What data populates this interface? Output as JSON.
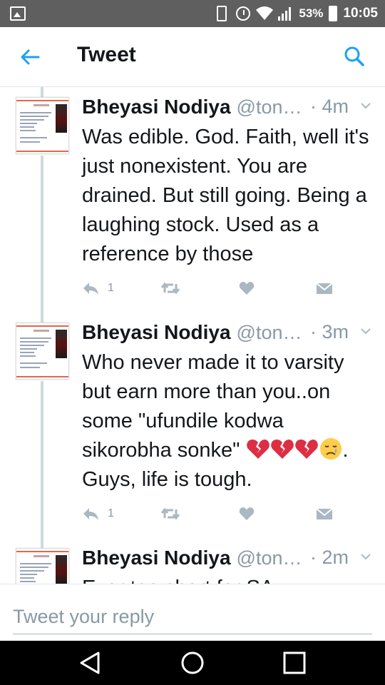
{
  "status_bar": {
    "battery": "53%",
    "time": "10:05"
  },
  "header": {
    "title": "Tweet"
  },
  "tweets": [
    {
      "name": "Bheyasi Nodiya",
      "handle": "@ton…",
      "time": "· 4m",
      "text": "Was edible. God. Faith, well it's just nonexistent. You are drained. But still going. Being a laughing stock. Used as a reference by those",
      "reply_count": "1"
    },
    {
      "name": "Bheyasi Nodiya",
      "handle": "@ton…",
      "time": "· 3m",
      "text_before_emoji": "Who never made it to varsity but earn more than you..on some \"ufundile kodwa sikorobha sonke\" ",
      "text_after_emoji": ". Guys, life is tough.",
      "emojis": [
        "broken-heart",
        "broken-heart",
        "broken-heart",
        "crying-face"
      ],
      "reply_count": "1"
    },
    {
      "name": "Bheyasi Nodiya",
      "handle": "@ton…",
      "time": "· 2m",
      "text": "Ever too short for SA..."
    }
  ],
  "reply": {
    "placeholder": "Tweet your reply"
  },
  "colors": {
    "accent": "#1da1f2",
    "status_bar": "#5f5f5f",
    "muted": "#8899a6",
    "thread_line": "#cfd9de"
  }
}
